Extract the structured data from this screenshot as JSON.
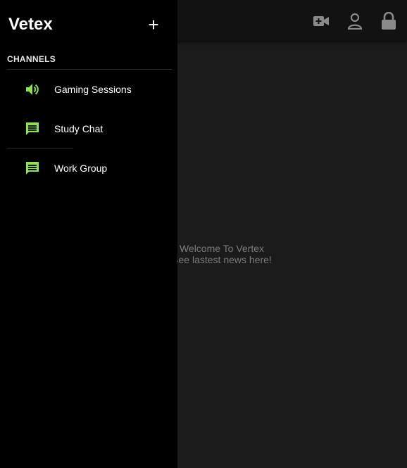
{
  "app": {
    "title": "Vetex",
    "add_label": "+"
  },
  "colors": {
    "accent": "#8ee05a",
    "drawer_bg": "#000000",
    "topbar_bg": "#121212",
    "content_bg": "#1b1b1b",
    "muted_text": "#7c7c7c",
    "icon_gray": "#8a8a8a"
  },
  "topbar": {
    "icons": [
      "video-add-icon",
      "user-icon",
      "lock-icon"
    ]
  },
  "sidebar": {
    "section_title": "CHANNELS",
    "items": [
      {
        "label": "Gaming Sessions",
        "icon": "volume-icon"
      },
      {
        "label": "Study Chat",
        "icon": "chat-icon"
      },
      {
        "label": "Work Group",
        "icon": "chat-icon"
      }
    ]
  },
  "main": {
    "welcome_line1": "Welcome To Vertex",
    "welcome_line2": "See lastest news here!"
  }
}
